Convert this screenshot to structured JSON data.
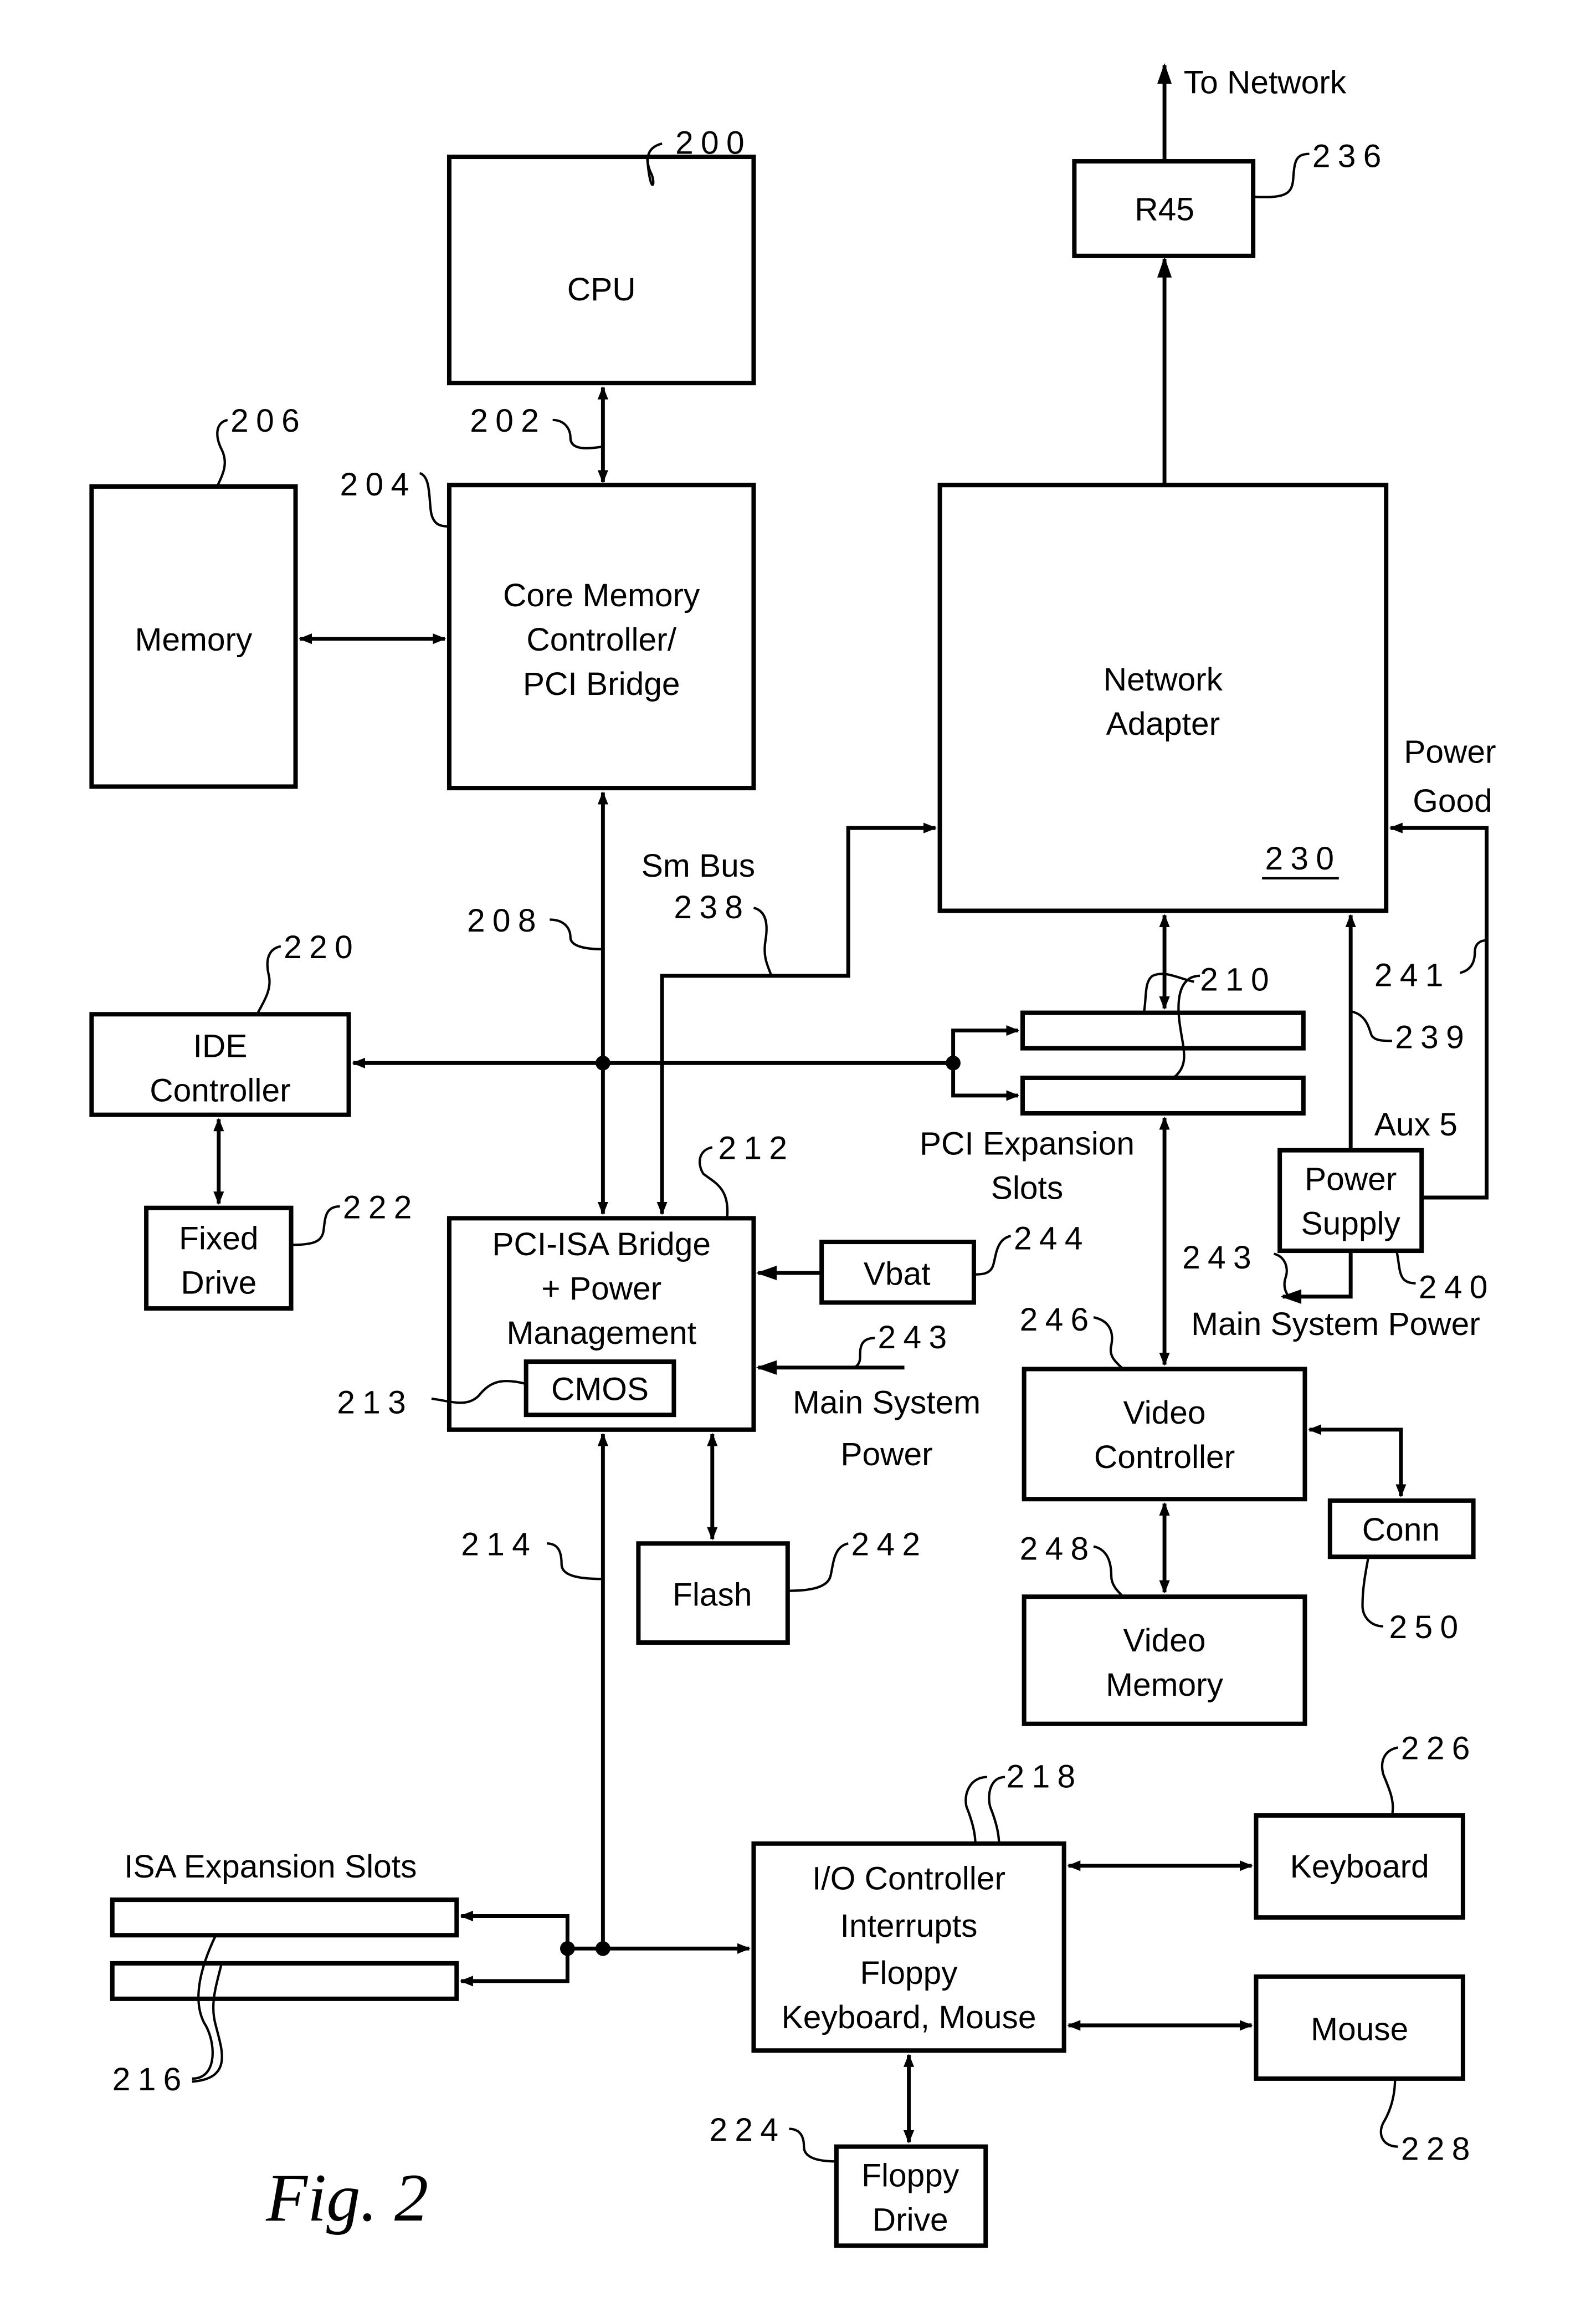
{
  "figure": {
    "label": "Fig. 2"
  },
  "blocks": {
    "cpu": {
      "label": [
        "CPU"
      ],
      "ref": "200"
    },
    "core_memory_controller": {
      "label": [
        "Core Memory",
        "Controller/",
        "PCI Bridge"
      ],
      "ref": "204"
    },
    "memory": {
      "label": [
        "Memory"
      ],
      "ref": "206"
    },
    "network_adapter": {
      "label": [
        "Network",
        "Adapter"
      ],
      "ref": "230"
    },
    "r45": {
      "label": [
        "R45"
      ],
      "ref": "236"
    },
    "ide_controller": {
      "label": [
        "IDE",
        "Controller"
      ],
      "ref": "220"
    },
    "fixed_drive": {
      "label": [
        "Fixed",
        "Drive"
      ],
      "ref": "222"
    },
    "pci_isa_bridge": {
      "label": [
        "PCI-ISA Bridge",
        "+ Power",
        "Management"
      ],
      "ref": "212"
    },
    "cmos": {
      "label": [
        "CMOS"
      ],
      "ref": "213"
    },
    "vbat": {
      "label": [
        "Vbat"
      ],
      "ref": "244"
    },
    "flash": {
      "label": [
        "Flash"
      ],
      "ref": "242"
    },
    "power_supply": {
      "label": [
        "Power",
        "Supply"
      ],
      "ref": "240"
    },
    "video_controller": {
      "label": [
        "Video",
        "Controller"
      ],
      "ref": "246"
    },
    "video_memory": {
      "label": [
        "Video",
        "Memory"
      ],
      "ref": "248"
    },
    "conn": {
      "label": [
        "Conn"
      ],
      "ref": "250"
    },
    "io_controller": {
      "label": [
        "I/O Controller",
        "Interrupts",
        "Floppy",
        "Keyboard, Mouse"
      ],
      "ref": "218"
    },
    "keyboard": {
      "label": [
        "Keyboard"
      ],
      "ref": "226"
    },
    "mouse": {
      "label": [
        "Mouse"
      ],
      "ref": "228"
    },
    "floppy_drive": {
      "label": [
        "Floppy",
        "Drive"
      ],
      "ref": "224"
    }
  },
  "slots": {
    "pci": {
      "label": [
        "PCI Expansion",
        "Slots"
      ],
      "ref": "210"
    },
    "isa": {
      "label": [
        "ISA Expansion Slots"
      ],
      "ref": "216"
    }
  },
  "buses": {
    "host_bus": {
      "ref": "202"
    },
    "pci_bus": {
      "ref": "208"
    },
    "isa_bus": {
      "ref": "214"
    },
    "sm_bus": {
      "label": "Sm Bus",
      "ref": "238"
    },
    "aux5": {
      "label": "Aux 5",
      "ref": "239"
    },
    "power_good": {
      "label": [
        "Power",
        "Good"
      ],
      "ref": "241"
    },
    "main_system_power_ps": {
      "label": "Main System Power",
      "ref": "243"
    },
    "main_system_power_bridge": {
      "label": [
        "Main System",
        "Power"
      ],
      "ref": "243"
    }
  },
  "annotations": {
    "to_network": "To Network"
  }
}
